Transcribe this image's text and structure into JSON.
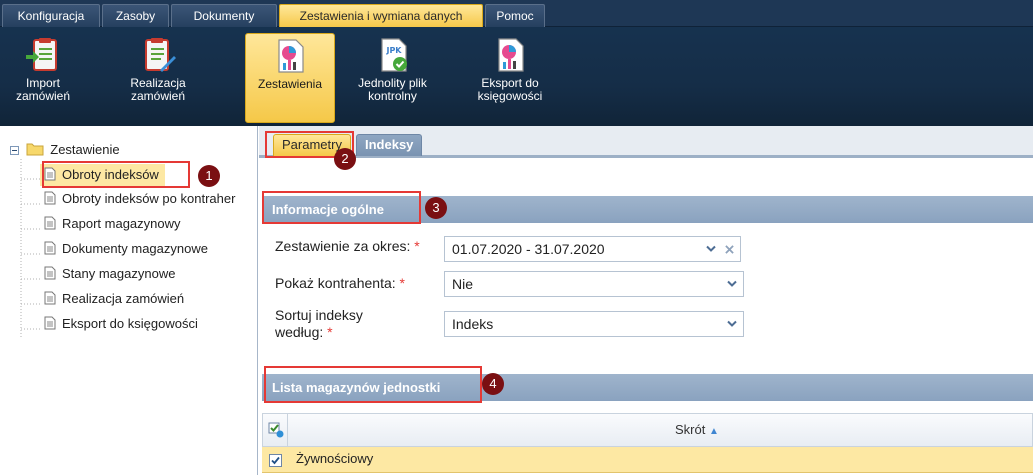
{
  "menu": {
    "tabs": [
      {
        "label": "Konfiguracja"
      },
      {
        "label": "Zasoby"
      },
      {
        "label": "Dokumenty"
      },
      {
        "label": "Zestawienia i wymiana danych"
      },
      {
        "label": "Pomoc"
      }
    ],
    "active_index": 3
  },
  "ribbon": {
    "buttons": [
      {
        "label": "Import zamówień",
        "icon": "import-orders-icon"
      },
      {
        "label": "Realizacja zamówień",
        "icon": "order-fulfillment-icon"
      },
      {
        "label": "Zestawienia",
        "icon": "reports-icon"
      },
      {
        "label": "Jednolity plik kontrolny",
        "icon": "jpk-icon",
        "icon_text": "JPK"
      },
      {
        "label": "Eksport do księgowości",
        "icon": "accounting-export-icon"
      }
    ],
    "active_index": 2
  },
  "tree": {
    "root_label": "Zestawienie",
    "items": [
      {
        "label": "Obroty indeksów"
      },
      {
        "label": "Obroty indeksów po kontraher"
      },
      {
        "label": "Raport magazynowy"
      },
      {
        "label": "Dokumenty magazynowe"
      },
      {
        "label": "Stany magazynowe"
      },
      {
        "label": "Realizacja zamówień"
      },
      {
        "label": "Eksport do księgowości"
      }
    ],
    "selected_index": 0
  },
  "tabs": {
    "items": [
      {
        "label": "Parametry"
      },
      {
        "label": "Indeksy"
      }
    ],
    "active_index": 0
  },
  "section_general": {
    "title": "Informacje ogólne",
    "fields": [
      {
        "label": "Zestawienie za okres:",
        "required_mark": "*",
        "value": "01.07.2020 - 31.07.2020"
      },
      {
        "label": "Pokaż kontrahenta:",
        "required_mark": "*",
        "value": "Nie"
      },
      {
        "label_line1": "Sortuj indeksy",
        "label_line2": "według:",
        "required_mark": "*",
        "value": "Indeks"
      }
    ]
  },
  "section_warehouses": {
    "title": "Lista magazynów jednostki",
    "column_header": "Skrót",
    "sort_indicator": "▲",
    "rows": [
      {
        "name": "Żywnościowy",
        "checked": true
      }
    ]
  },
  "annotations": [
    "1",
    "2",
    "3",
    "4"
  ],
  "colors": {
    "dark_blue": "#16324f",
    "accent_yellow": "#f5c848",
    "highlight_red": "#e53935",
    "badge_red": "#7a0f12"
  }
}
